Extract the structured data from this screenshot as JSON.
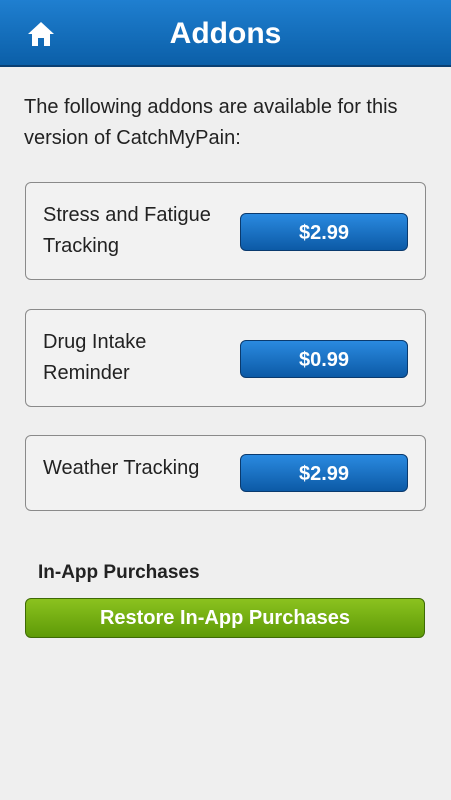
{
  "header": {
    "title": "Addons",
    "home_icon": "home-icon"
  },
  "intro_text": "The following addons are available for this version of CatchMyPain:",
  "addons": [
    {
      "name": "Stress and Fatigue Tracking",
      "price": "$2.99"
    },
    {
      "name": "Drug Intake Reminder",
      "price": "$0.99"
    },
    {
      "name": "Weather Tracking",
      "price": "$2.99"
    }
  ],
  "in_app": {
    "section_title": "In-App Purchases",
    "restore_label": "Restore In-App Purchases"
  },
  "colors": {
    "header_blue": "#1570c0",
    "price_button_blue": "#1a74c8",
    "restore_green": "#72ad10",
    "background": "#efefef"
  }
}
